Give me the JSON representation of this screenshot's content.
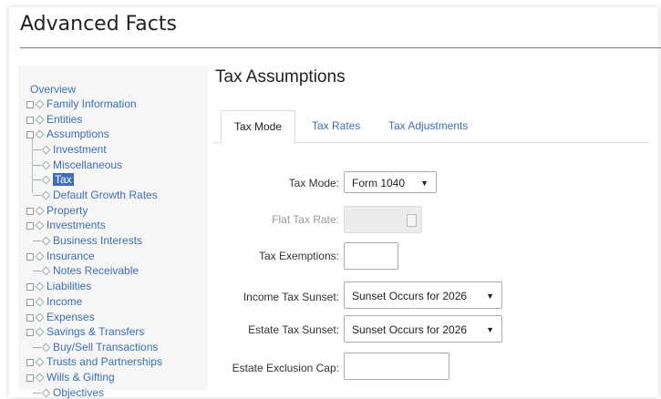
{
  "app_title": "Advanced Facts",
  "sidebar": {
    "items": [
      {
        "label": "Overview"
      },
      {
        "label": "Family Information"
      },
      {
        "label": "Entities"
      },
      {
        "label": "Assumptions"
      },
      {
        "label": "Investment"
      },
      {
        "label": "Miscellaneous"
      },
      {
        "label": "Tax"
      },
      {
        "label": "Default Growth Rates"
      },
      {
        "label": "Property"
      },
      {
        "label": "Investments"
      },
      {
        "label": "Business Interests"
      },
      {
        "label": "Insurance"
      },
      {
        "label": "Notes Receivable"
      },
      {
        "label": "Liabilities"
      },
      {
        "label": "Income"
      },
      {
        "label": "Expenses"
      },
      {
        "label": "Savings & Transfers"
      },
      {
        "label": "Buy/Sell Transactions"
      },
      {
        "label": "Trusts and Partnerships"
      },
      {
        "label": "Wills & Gifting"
      },
      {
        "label": "Objectives"
      }
    ]
  },
  "main": {
    "title": "Tax Assumptions",
    "tabs": [
      {
        "label": "Tax Mode"
      },
      {
        "label": "Tax Rates"
      },
      {
        "label": "Tax Adjustments"
      }
    ],
    "form": {
      "tax_mode_label": "Tax Mode:",
      "tax_mode_value": "Form 1040",
      "flat_tax_rate_label": "Flat Tax Rate:",
      "tax_exemptions_label": "Tax Exemptions:",
      "income_tax_sunset_label": "Income Tax Sunset:",
      "income_tax_sunset_value": "Sunset Occurs for 2026",
      "estate_tax_sunset_label": "Estate Tax Sunset:",
      "estate_tax_sunset_value": "Sunset Occurs for 2026",
      "estate_exclusion_cap_label": "Estate Exclusion Cap:"
    }
  },
  "colors": {
    "link": "#3d6eb6",
    "selected_bg": "#3d6eb6"
  }
}
